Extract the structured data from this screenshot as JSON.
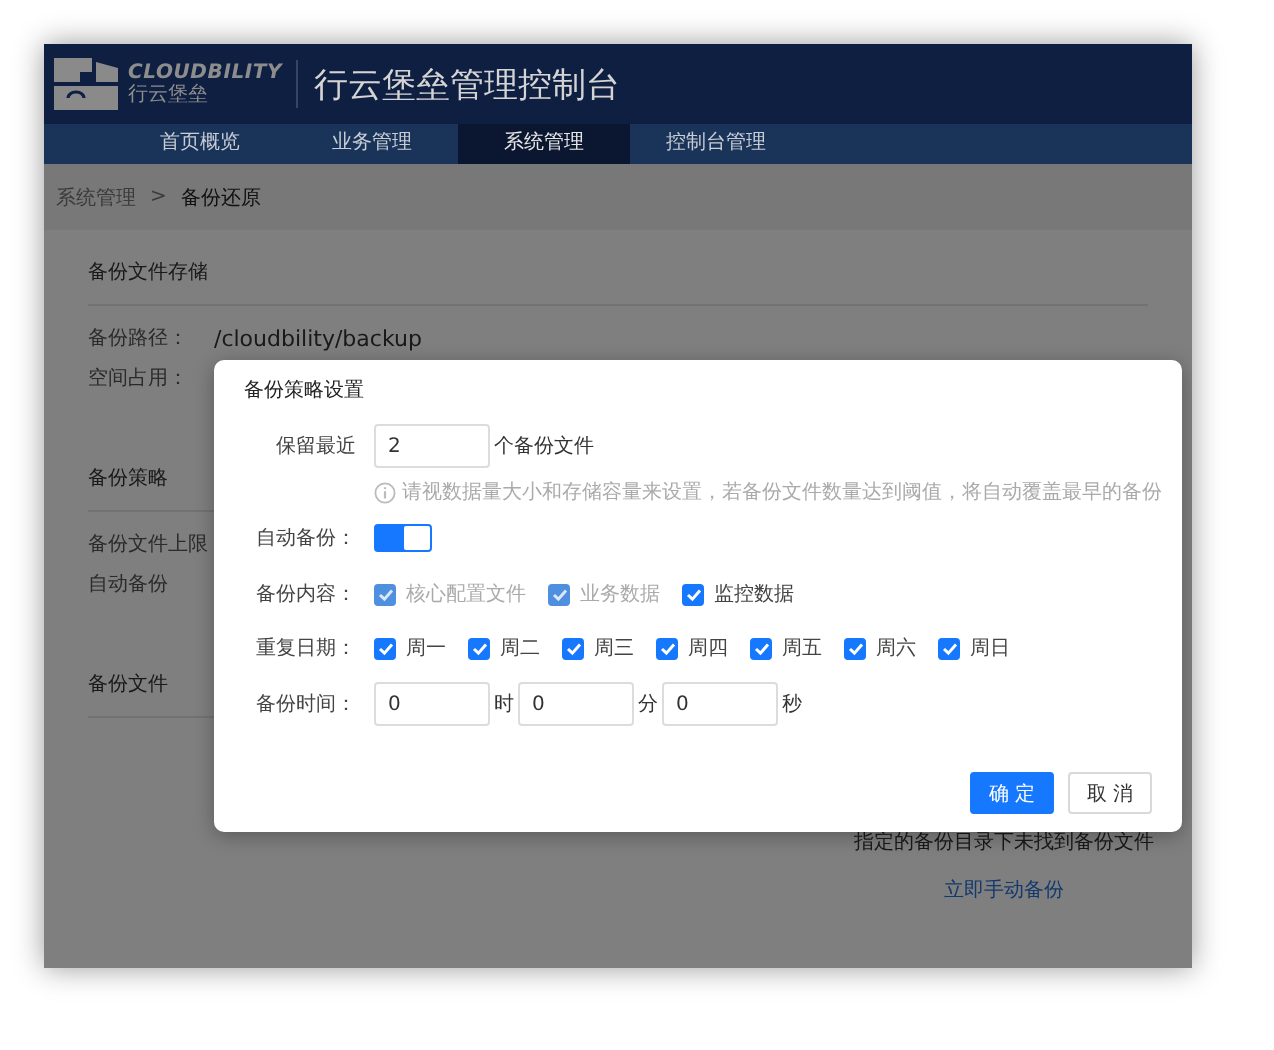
{
  "header": {
    "logo_text": "CLOUDBILITY",
    "logo_subtext": "行云堡垒",
    "title": "行云堡垒管理控制台"
  },
  "nav": [
    {
      "label": "首页概览",
      "selected": false
    },
    {
      "label": "业务管理",
      "selected": false
    },
    {
      "label": "系统管理",
      "selected": true
    },
    {
      "label": "控制台管理",
      "selected": false
    }
  ],
  "breadcrumb": {
    "items": [
      "系统管理",
      "备份还原"
    ],
    "separator": ">"
  },
  "sections": [
    {
      "title": "备份文件存储",
      "fields": [
        {
          "label": "备份路径：",
          "value": "/cloudbility/backup"
        },
        {
          "label": "空间占用："
        }
      ]
    },
    {
      "title": "备份策略",
      "fields": [
        {
          "label": "备份文件上限"
        },
        {
          "label": "自动备份"
        }
      ]
    },
    {
      "title": "备份文件",
      "empty_message": "指定的备份目录下未找到备份文件",
      "action_link": "立即手动备份"
    }
  ],
  "dialog": {
    "title": "备份策略设置",
    "retain": {
      "label": "保留最近",
      "value": "2",
      "suffix": "个备份文件",
      "hint": "请视数据量大小和存储容量来设置，若备份文件数量达到阈值，将自动覆盖最早的备份"
    },
    "auto_backup": {
      "label": "自动备份：",
      "on": true
    },
    "content": {
      "label": "备份内容：",
      "options": [
        {
          "label": "核心配置文件",
          "checked": true,
          "disabled": true
        },
        {
          "label": "业务数据",
          "checked": true,
          "disabled": true
        },
        {
          "label": "监控数据",
          "checked": true,
          "disabled": false
        }
      ]
    },
    "repeat_days": {
      "label": "重复日期：",
      "options": [
        {
          "label": "周一",
          "checked": true
        },
        {
          "label": "周二",
          "checked": true
        },
        {
          "label": "周三",
          "checked": true
        },
        {
          "label": "周四",
          "checked": true
        },
        {
          "label": "周五",
          "checked": true
        },
        {
          "label": "周六",
          "checked": true
        },
        {
          "label": "周日",
          "checked": true
        }
      ]
    },
    "time": {
      "label": "备份时间：",
      "fields": [
        {
          "value": "0",
          "unit": "时"
        },
        {
          "value": "0",
          "unit": "分"
        },
        {
          "value": "0",
          "unit": "秒"
        }
      ]
    },
    "buttons": [
      {
        "label": "确定",
        "kind": "primary"
      },
      {
        "label": "取消",
        "kind": "default"
      }
    ]
  }
}
